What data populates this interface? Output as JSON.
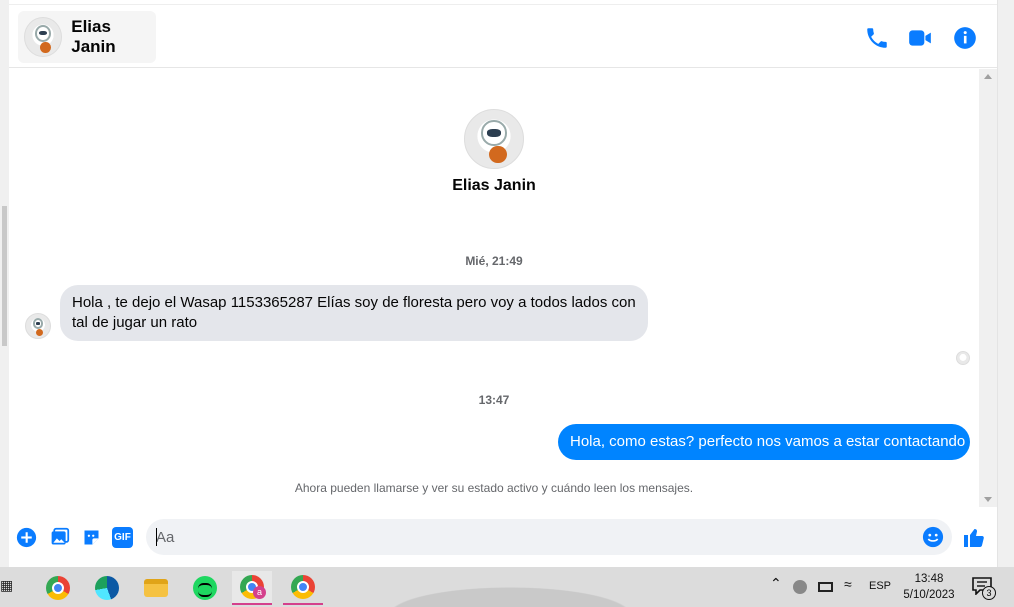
{
  "contact": {
    "name": "Elias Janin"
  },
  "header_actions": {
    "call_icon": "phone-icon",
    "video_icon": "video-camera-icon",
    "info_icon": "info-icon"
  },
  "profile": {
    "name": "Elias Janin"
  },
  "conversation": {
    "timestamp_1": "Mié, 21:49",
    "incoming_message": "Hola , te dejo el Wasap 1153365287 Elías soy de floresta pero voy a todos lados con tal de jugar un rato",
    "timestamp_2": "13:47",
    "outgoing_message": "Hola, como estas? perfecto nos vamos a estar contactando",
    "notice": "Ahora pueden llamarse y ver su estado activo y cuándo leen los mensajes."
  },
  "composer": {
    "placeholder": "Aa",
    "value": "",
    "actions": [
      "plus-circle-icon",
      "image-icon",
      "sticker-icon",
      "gif-icon",
      "emoji-icon",
      "thumbs-up-icon"
    ],
    "gif_label": "GIF"
  },
  "taskbar": {
    "apps": [
      "chrome-icon",
      "edge-icon",
      "file-explorer-icon",
      "spotify-icon",
      "chrome-profile-icon",
      "chrome-icon"
    ],
    "badge_text": "a",
    "language": "ESP",
    "time": "13:48",
    "date": "5/10/2023",
    "notification_count": "3"
  },
  "colors": {
    "accent": "#0084ff",
    "incoming_bubble": "#e4e6eb",
    "text": "#050505",
    "muted": "#65676b"
  }
}
